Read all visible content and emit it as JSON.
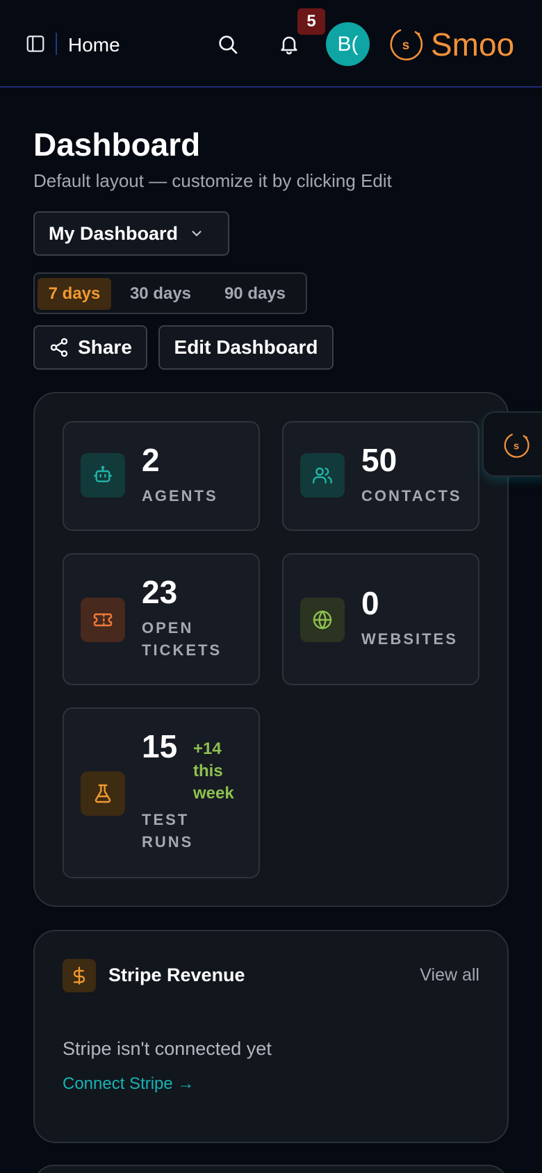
{
  "topbar": {
    "breadcrumb": "Home",
    "notification_count": "5",
    "avatar_initials": "B(",
    "brand_name": "Smoo",
    "brand_mark_letter": "s",
    "brand_color": "#f2913a"
  },
  "header": {
    "title": "Dashboard",
    "subtitle": "Default layout — customize it by clicking Edit",
    "dashboard_select": "My Dashboard"
  },
  "range": {
    "options": [
      "7 days",
      "30 days",
      "90 days"
    ],
    "selected": "7 days",
    "accent": "#f29a2e"
  },
  "actions": {
    "share": "Share",
    "edit": "Edit Dashboard"
  },
  "stats": [
    {
      "value": "2",
      "label_lines": [
        "AGENTS"
      ],
      "icon": "bot-icon",
      "color": "#1fb5a8"
    },
    {
      "value": "50",
      "label_lines": [
        "CONTACTS"
      ],
      "icon": "users-icon",
      "color": "#1fb5a8"
    },
    {
      "value": "23",
      "label_lines": [
        "OPEN",
        "TICKETS"
      ],
      "icon": "ticket-icon",
      "color": "#f07a3c"
    },
    {
      "value": "0",
      "label_lines": [
        "WEBSITES"
      ],
      "icon": "globe-icon",
      "color": "#8ec04f"
    },
    {
      "value": "15",
      "label_lines": [
        "TEST",
        "RUNS"
      ],
      "icon": "flask-icon",
      "color": "#f29a2e",
      "delta_lines": [
        "+14",
        "this",
        "week"
      ]
    }
  ],
  "revenue": {
    "title": "Stripe Revenue",
    "view_all": "View all",
    "message": "Stripe isn't connected yet",
    "connect_link": "Connect Stripe →",
    "icon": "dollar-icon"
  }
}
